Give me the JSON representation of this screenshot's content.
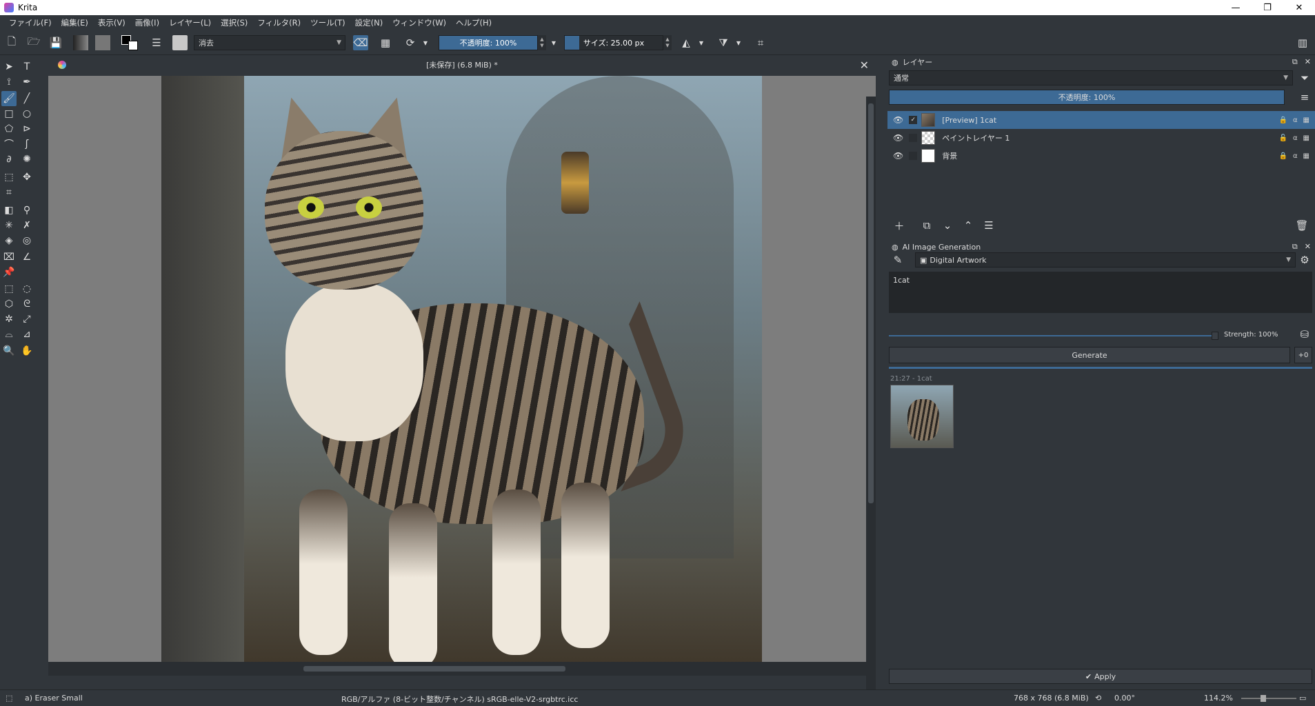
{
  "window": {
    "title": "Krita",
    "minimize": "—",
    "maximize": "❐",
    "close": "✕"
  },
  "menu": [
    "ファイル(F)",
    "編集(E)",
    "表示(V)",
    "画像(I)",
    "レイヤー(L)",
    "選択(S)",
    "フィルタ(R)",
    "ツール(T)",
    "設定(N)",
    "ウィンドウ(W)",
    "ヘルプ(H)"
  ],
  "toolbar": {
    "brush_preset": "消去",
    "opacity_label": "不透明度: 100%",
    "opacity_value": 1.0,
    "size_label": "サイズ: 25.00 px",
    "size_value": 0.15
  },
  "document": {
    "title": "[未保存]  (6.8 MiB) *"
  },
  "layers": {
    "header": "レイヤー",
    "blend_mode": "通常",
    "opacity_label": "不透明度: 100%",
    "items": [
      {
        "name": "[Preview] 1cat",
        "selected": true
      },
      {
        "name": "ペイントレイヤー 1",
        "selected": false
      },
      {
        "name": "背景",
        "selected": false
      }
    ]
  },
  "ai": {
    "header": "AI Image Generation",
    "style": "Digital Artwork",
    "prompt": "1cat",
    "strength_label": "Strength: 100%",
    "strength_value": 1.0,
    "generate_label": "Generate",
    "seed_label": "+0",
    "history_label": "21:27 - 1cat",
    "apply_label": "Apply"
  },
  "status": {
    "brush": "a) Eraser Small",
    "colorspace": "RGB/アルファ (8-ビット整数/チャンネル)  sRGB-elle-V2-srgbtrc.icc",
    "dimensions": "768 x 768 (6.8 MiB)",
    "rotation": "0.00°",
    "zoom": "114.2%"
  },
  "colors": {
    "accent": "#3d6a95",
    "panel": "#31363b",
    "titlebar": "#ffffff"
  }
}
